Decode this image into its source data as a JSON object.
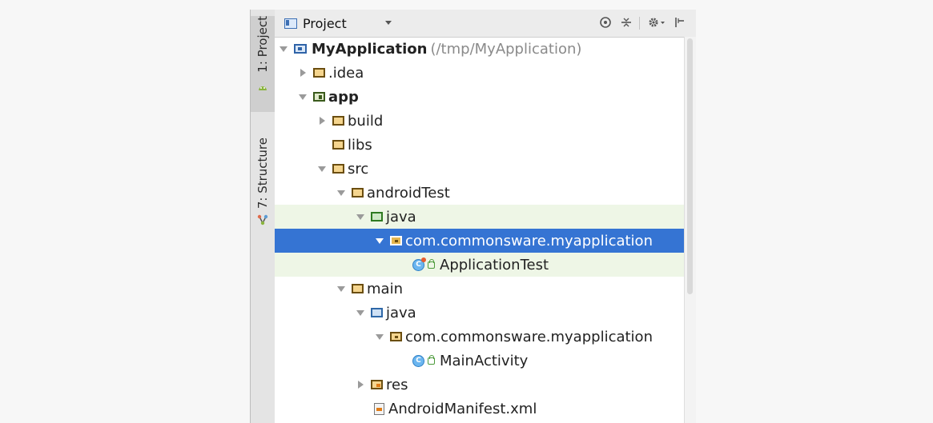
{
  "sidebar": {
    "tabs": [
      {
        "label": "1: Project",
        "icon": "android-icon"
      },
      {
        "label": "7: Structure",
        "icon": "structure-icon"
      }
    ]
  },
  "toolbar": {
    "view_label": "Project",
    "icons": [
      "target-icon",
      "collapse-all-icon",
      "gear-icon",
      "hide-panel-icon"
    ]
  },
  "tree": {
    "root_name": "MyApplication",
    "root_path": "(/tmp/MyApplication)",
    "idea": ".idea",
    "app": "app",
    "build": "build",
    "libs": "libs",
    "src": "src",
    "android_test": "androidTest",
    "java_test": "java",
    "test_package": "com.commonsware.myapplication",
    "test_class": "ApplicationTest",
    "main": "main",
    "java_main": "java",
    "main_package": "com.commonsware.myapplication",
    "main_class": "MainActivity",
    "res": "res",
    "manifest": "AndroidManifest.xml"
  },
  "colors": {
    "selection": "#3574d3",
    "test_highlight": "#eef6e6"
  }
}
